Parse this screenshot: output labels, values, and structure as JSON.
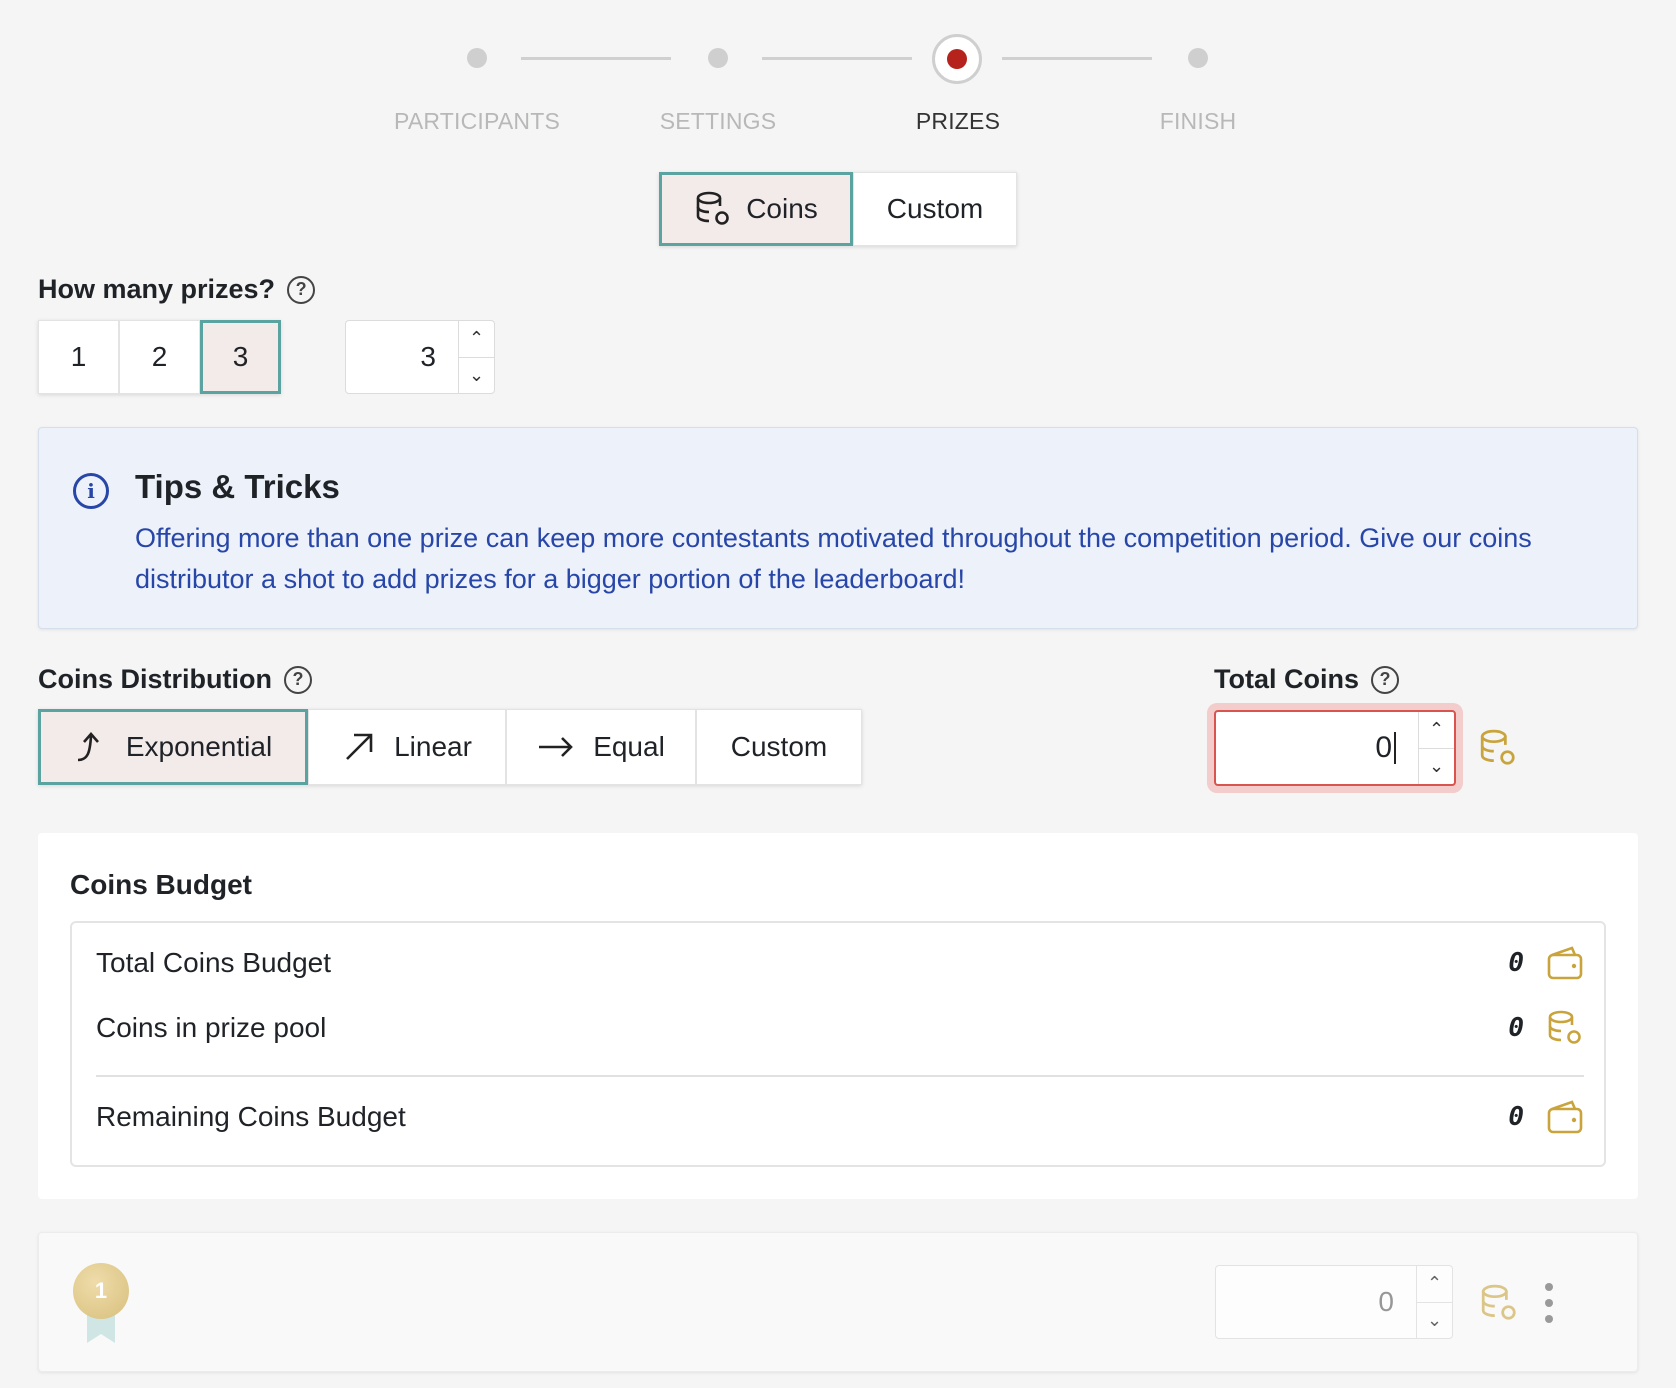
{
  "stepper": {
    "steps": [
      {
        "label": "PARTICIPANTS"
      },
      {
        "label": "SETTINGS"
      },
      {
        "label": "PRIZES",
        "active": true
      },
      {
        "label": "FINISH"
      }
    ]
  },
  "prize_type": {
    "coins_label": "Coins",
    "custom_label": "Custom",
    "selected": "Coins"
  },
  "prizes_count": {
    "label": "How many prizes?",
    "options": [
      "1",
      "2",
      "3"
    ],
    "selected": "3",
    "input_value": "3"
  },
  "tips": {
    "title": "Tips & Tricks",
    "body": "Offering more than one prize can keep more contestants motivated throughout the competition period. Give our coins distributor a shot to add prizes for a bigger portion of the leaderboard!"
  },
  "distribution": {
    "label": "Coins Distribution",
    "options": [
      "Exponential",
      "Linear",
      "Equal",
      "Custom"
    ],
    "selected": "Exponential"
  },
  "total_coins": {
    "label": "Total Coins",
    "value": "0"
  },
  "budget": {
    "title": "Coins Budget",
    "rows": [
      {
        "label": "Total Coins Budget",
        "value": "0",
        "icon": "wallet-icon"
      },
      {
        "label": "Coins in prize pool",
        "value": "0",
        "icon": "coins-icon"
      },
      {
        "label": "Remaining Coins Budget",
        "value": "0",
        "icon": "wallet-icon"
      }
    ]
  },
  "prize_row": {
    "rank": "1",
    "value": "0"
  },
  "colors": {
    "accent": "#5aa3a0",
    "active_step": "#b5231c",
    "coin": "#c9a43d",
    "tips_text": "#2746a8",
    "error": "#d9534f"
  }
}
